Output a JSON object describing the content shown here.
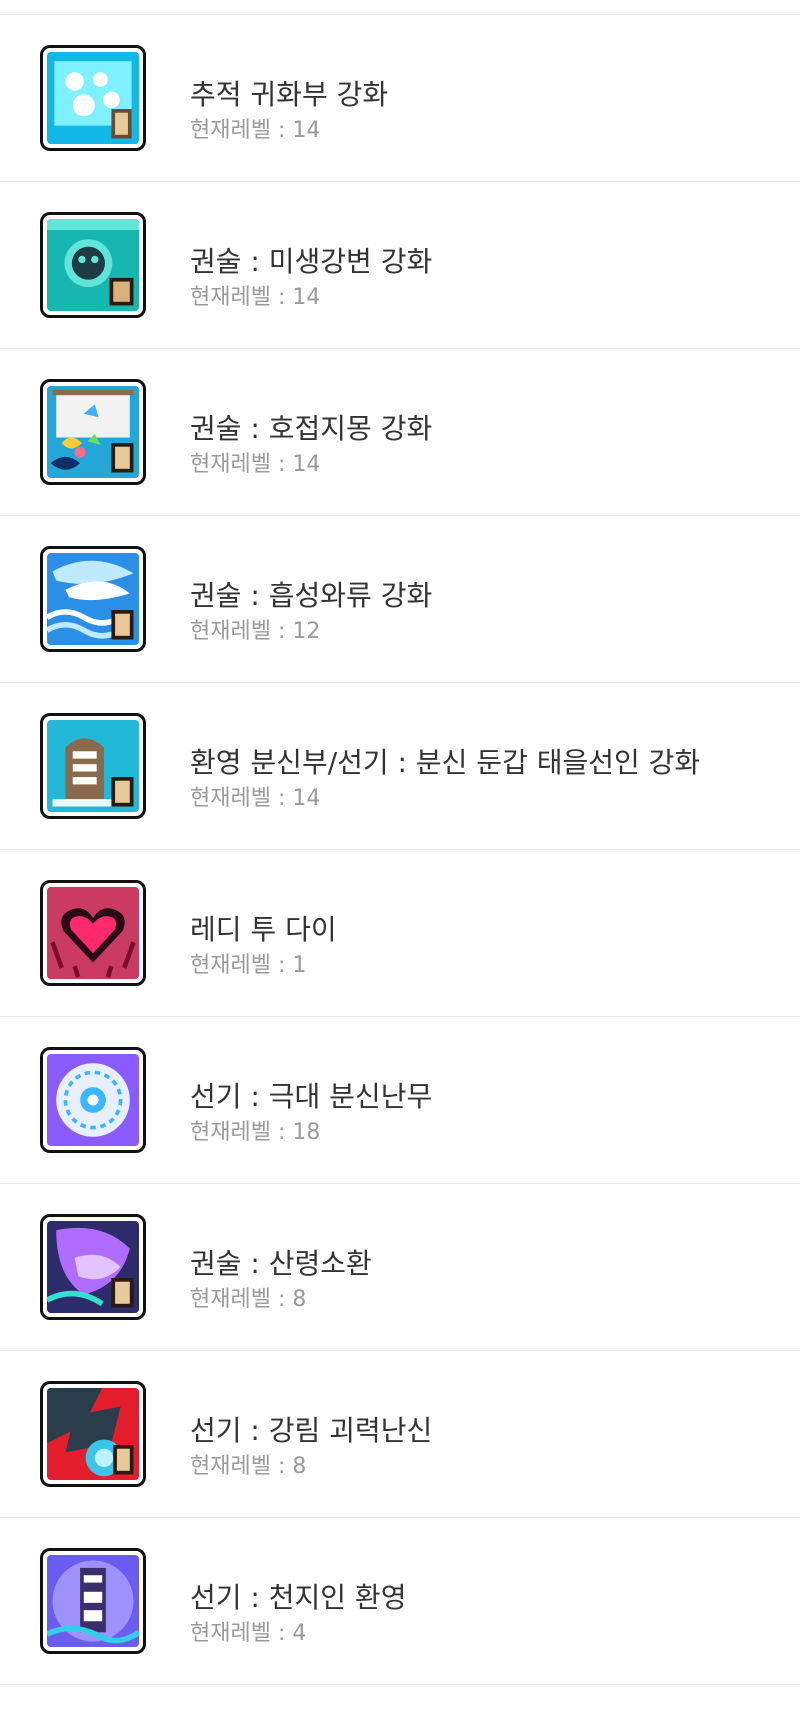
{
  "skills": [
    {
      "title": "추적 귀화부 강화",
      "level": "현재레벨 : 14",
      "icon": "talisman-book-icon",
      "colors": [
        "#12b8e8",
        "#7ef0ff",
        "#ffffff"
      ]
    },
    {
      "title": "권술 : 미생강변 강화",
      "level": "현재레벨 : 14",
      "icon": "round-face-book-icon",
      "colors": [
        "#18b6b0",
        "#5fe6d9",
        "#1f3b46"
      ]
    },
    {
      "title": "권술 : 호접지몽 강화",
      "level": "현재레벨 : 14",
      "icon": "butterfly-scroll-icon",
      "colors": [
        "#23a7d9",
        "#f2f2f2",
        "#ff6c8a"
      ]
    },
    {
      "title": "권술 : 흡성와류 강화",
      "level": "현재레벨 : 12",
      "icon": "vortex-book-icon",
      "colors": [
        "#2b8fe8",
        "#bfe9ff",
        "#ffffff"
      ]
    },
    {
      "title": "환영 분신부/선기 : 분신 둔갑 태을선인 강화",
      "level": "현재레벨 : 14",
      "icon": "tombstone-book-icon",
      "colors": [
        "#22b9d8",
        "#8a6a4d",
        "#ffffff"
      ]
    },
    {
      "title": "레디 투 다이",
      "level": "현재레벨 : 1",
      "icon": "dark-heart-icon",
      "colors": [
        "#ff2a6b",
        "#2a0a18",
        "#c21946"
      ]
    },
    {
      "title": "선기 : 극대 분신난무",
      "level": "현재레벨 : 18",
      "icon": "magic-circle-icon",
      "colors": [
        "#8a5cff",
        "#e8f0ff",
        "#3bb7ff"
      ]
    },
    {
      "title": "권술 : 산령소환",
      "level": "현재레벨 : 8",
      "icon": "spirit-summon-book-icon",
      "colors": [
        "#b06cff",
        "#2c2c6a",
        "#34e0d0"
      ]
    },
    {
      "title": "선기 : 강림 괴력난신",
      "level": "현재레벨 : 8",
      "icon": "dragon-book-icon",
      "colors": [
        "#2a3d4a",
        "#e31d2b",
        "#39c6e8"
      ]
    },
    {
      "title": "선기 : 천지인 환영",
      "level": "현재레벨 : 4",
      "icon": "heaven-earth-icon",
      "colors": [
        "#6a5cf0",
        "#b6a8ff",
        "#2fd0e6"
      ]
    }
  ]
}
